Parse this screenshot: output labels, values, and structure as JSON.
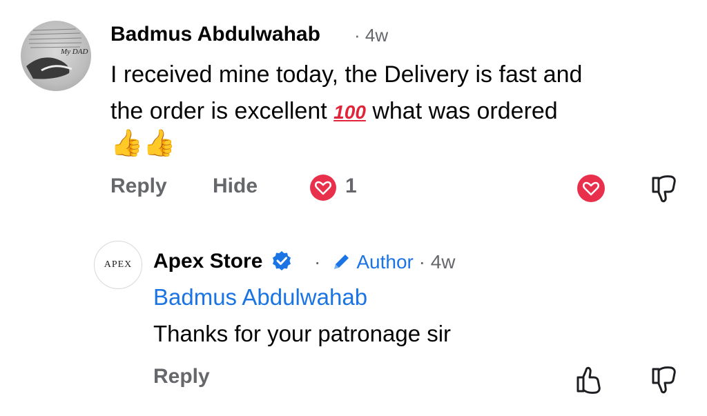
{
  "comment": {
    "author": "Badmus Abdulwahab",
    "separator": "·",
    "time": "4w",
    "text_line1": "I received mine today, the Delivery is fast and",
    "text_before_emoji": "the order is excellent ",
    "emoji": "100",
    "text_after_emoji": " what was ordered",
    "avatar_caption": "My DAD",
    "actions": {
      "reply": "Reply",
      "hide": "Hide",
      "reaction_count": "1"
    }
  },
  "reply": {
    "author": "Apex Store",
    "verified": true,
    "separator": "·",
    "author_badge": "Author",
    "time": "4w",
    "mention": "Badmus Abdulwahab",
    "text": "Thanks for your patronage sir",
    "avatar_logo": "APEX",
    "actions": {
      "reply": "Reply"
    }
  },
  "icons": {
    "thumbs_up_emoji": "👍👍",
    "heart": "heart-icon",
    "dislike": "thumbs-down-icon",
    "like": "thumbs-up-icon",
    "verified": "verified-badge-icon",
    "pencil": "pencil-icon"
  },
  "colors": {
    "link_blue": "#1b74e4",
    "heart_red": "#e8304d",
    "muted": "#65676b"
  }
}
